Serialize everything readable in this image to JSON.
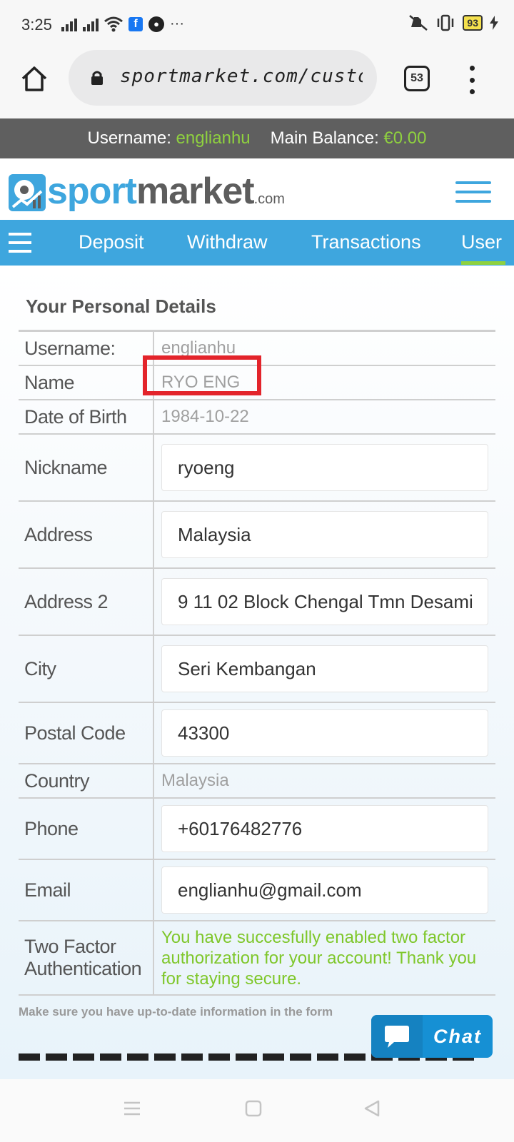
{
  "status_bar": {
    "time": "3:25",
    "battery": "93",
    "more": "···"
  },
  "browser": {
    "url": "sportmarket.com/custo",
    "tab_count": "53"
  },
  "account_strip": {
    "username_label": "Username:",
    "username": "englianhu",
    "balance_label": "Main Balance:",
    "balance": "€0.00"
  },
  "logo": {
    "sport": "sport",
    "market": "market",
    "com": ".com"
  },
  "nav": {
    "items": [
      "Deposit",
      "Withdraw",
      "Transactions",
      "User"
    ]
  },
  "page": {
    "section_title": "Your Personal Details",
    "fields": {
      "username": {
        "label": "Username:",
        "value": "englianhu"
      },
      "name": {
        "label": "Name",
        "value": "RYO ENG"
      },
      "dob": {
        "label": "Date of Birth",
        "value": "1984-10-22"
      },
      "nickname": {
        "label": "Nickname",
        "value": "ryoeng"
      },
      "address": {
        "label": "Address",
        "value": "Malaysia"
      },
      "address2": {
        "label": "Address 2",
        "value": "9 11 02 Block Chengal Tmn Desami"
      },
      "city": {
        "label": "City",
        "value": "Seri Kembangan"
      },
      "postal": {
        "label": "Postal Code",
        "value": "43300"
      },
      "country": {
        "label": "Country",
        "value": "Malaysia"
      },
      "phone": {
        "label": "Phone",
        "value": "+60176482776"
      },
      "email": {
        "label": "Email",
        "value": "englianhu@gmail.com"
      },
      "two_factor": {
        "label": "Two Factor Authentication",
        "value": "You have succesfully enabled two factor authorization for your account! Thank you for staying secure."
      }
    },
    "note": "Make sure you have up-to-date information in the form"
  },
  "chat": {
    "label": "Chat"
  },
  "colors": {
    "brand_blue": "#3ea6de",
    "accent_green": "#8fd13f",
    "highlight_red": "#e3242b"
  }
}
